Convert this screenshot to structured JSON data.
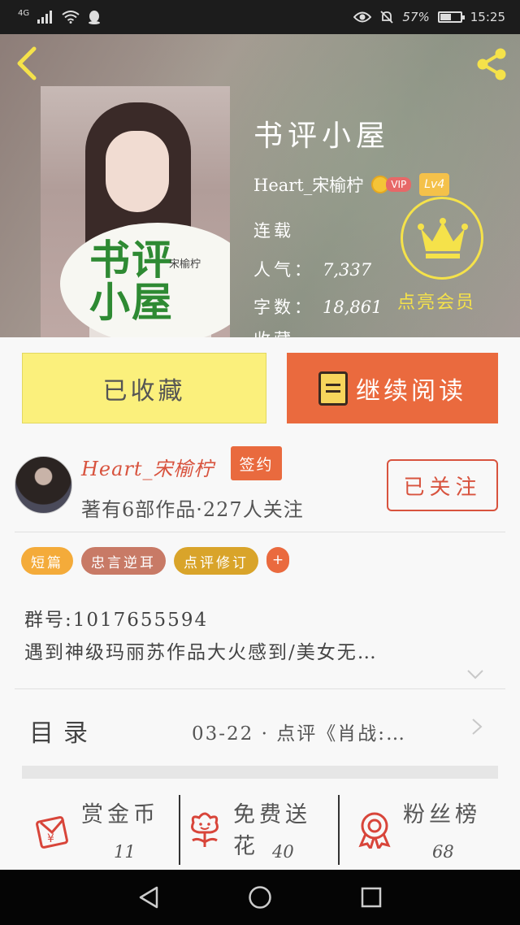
{
  "status_bar": {
    "network": "4G",
    "battery_percent": "57%",
    "battery_level": 0.57,
    "time": "15:25"
  },
  "hero": {
    "cover_title": "书评小屋",
    "cover_author": "宋榆柠",
    "book_title": "书评小屋",
    "author_name": "Heart_宋榆柠",
    "vip_badge": "VIP",
    "level_badge": "Lv4",
    "status": "连载",
    "popularity_label": "人气：",
    "popularity_value": "7,337",
    "word_count_label": "字数：",
    "word_count_value": "18,861",
    "collect_label_partial": "收藏",
    "vip_cta": "点亮会员",
    "colors": {
      "accent_yellow": "#f5e24a"
    }
  },
  "buttons": {
    "collected": "已收藏",
    "continue_reading": "继续阅读"
  },
  "author": {
    "name": "Heart_宋榆柠",
    "signed": "签约",
    "stats": "著有6部作品·227人关注",
    "follow": "已关注"
  },
  "tags": [
    {
      "label": "短篇",
      "color": "#f4ab3a"
    },
    {
      "label": "忠言逆耳",
      "color": "#c87a66"
    },
    {
      "label": "点评修订",
      "color": "#d9a42a"
    },
    {
      "label": "+",
      "color": "#ea6a3e"
    }
  ],
  "description": {
    "line1": "群号:1017655594",
    "line2": "遇到神级玛丽苏作品大火感到/美女无…"
  },
  "toc": {
    "label": "目录",
    "latest": "03-22 · 点评《肖战:…"
  },
  "actions": [
    {
      "label": "赏金币",
      "count": "11",
      "icon": "red-envelope-icon"
    },
    {
      "label": "免费送花",
      "count": "40",
      "icon": "flower-icon"
    },
    {
      "label": "粉丝榜",
      "count": "68",
      "icon": "medal-icon"
    }
  ],
  "nav_bar": {
    "icons": [
      "back-triangle-icon",
      "home-circle-icon",
      "recents-square-icon"
    ]
  }
}
